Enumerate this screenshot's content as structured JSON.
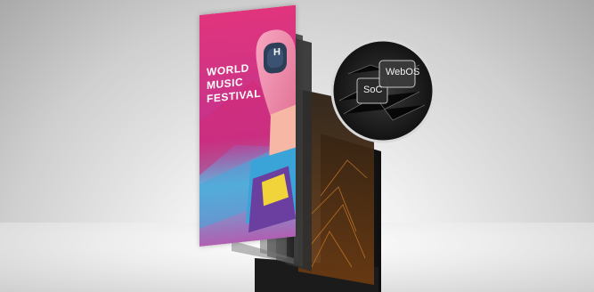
{
  "poster": {
    "line1": "WORLD",
    "line2": "MUSIC",
    "line3": "FESTIVAL",
    "headphone_badge": "H"
  },
  "chips": {
    "soc": "SoC",
    "webos": "WebOS"
  }
}
